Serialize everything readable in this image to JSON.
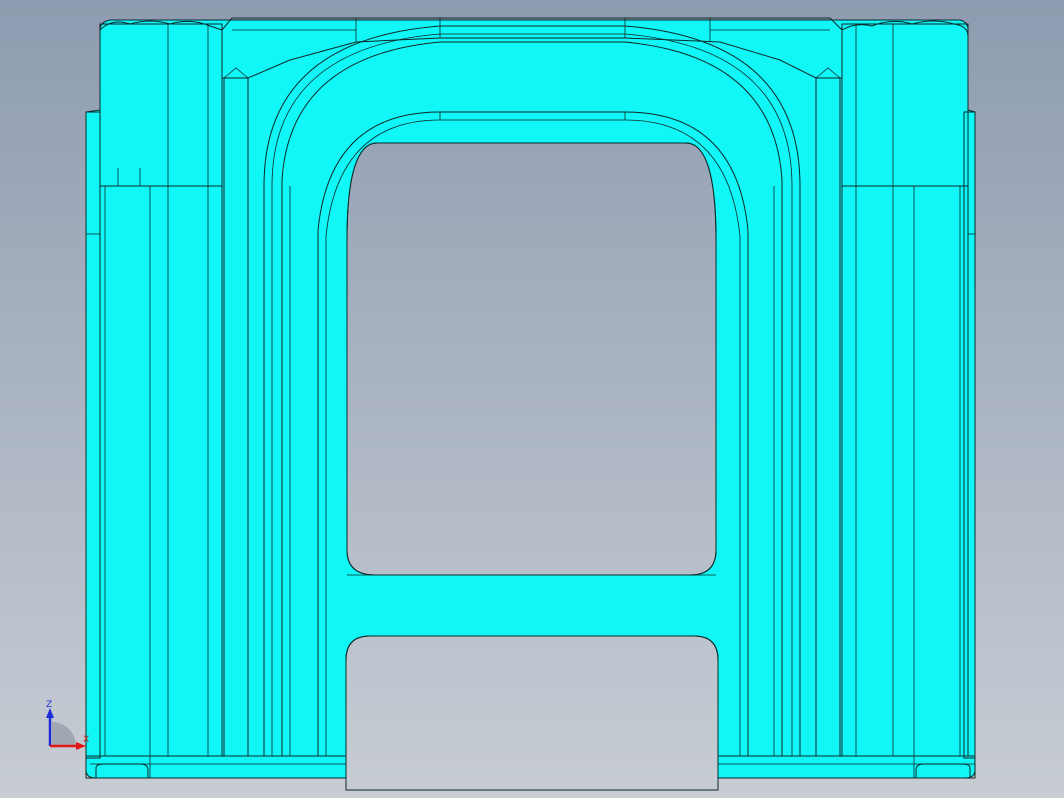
{
  "viewport": {
    "background_top": "#8e9bb0",
    "background_bottom": "#c7ccd3",
    "part_color": "#11f7f7",
    "part_highlight": "#c8ffff",
    "part_shade": "#07c9d3",
    "edge_color": "#0a2a2a"
  },
  "triad": {
    "z_label": "Z",
    "x_label": "X",
    "z_color": "#1a2bd8",
    "x_color": "#e01818",
    "origin_color": "#9aa0ad"
  }
}
